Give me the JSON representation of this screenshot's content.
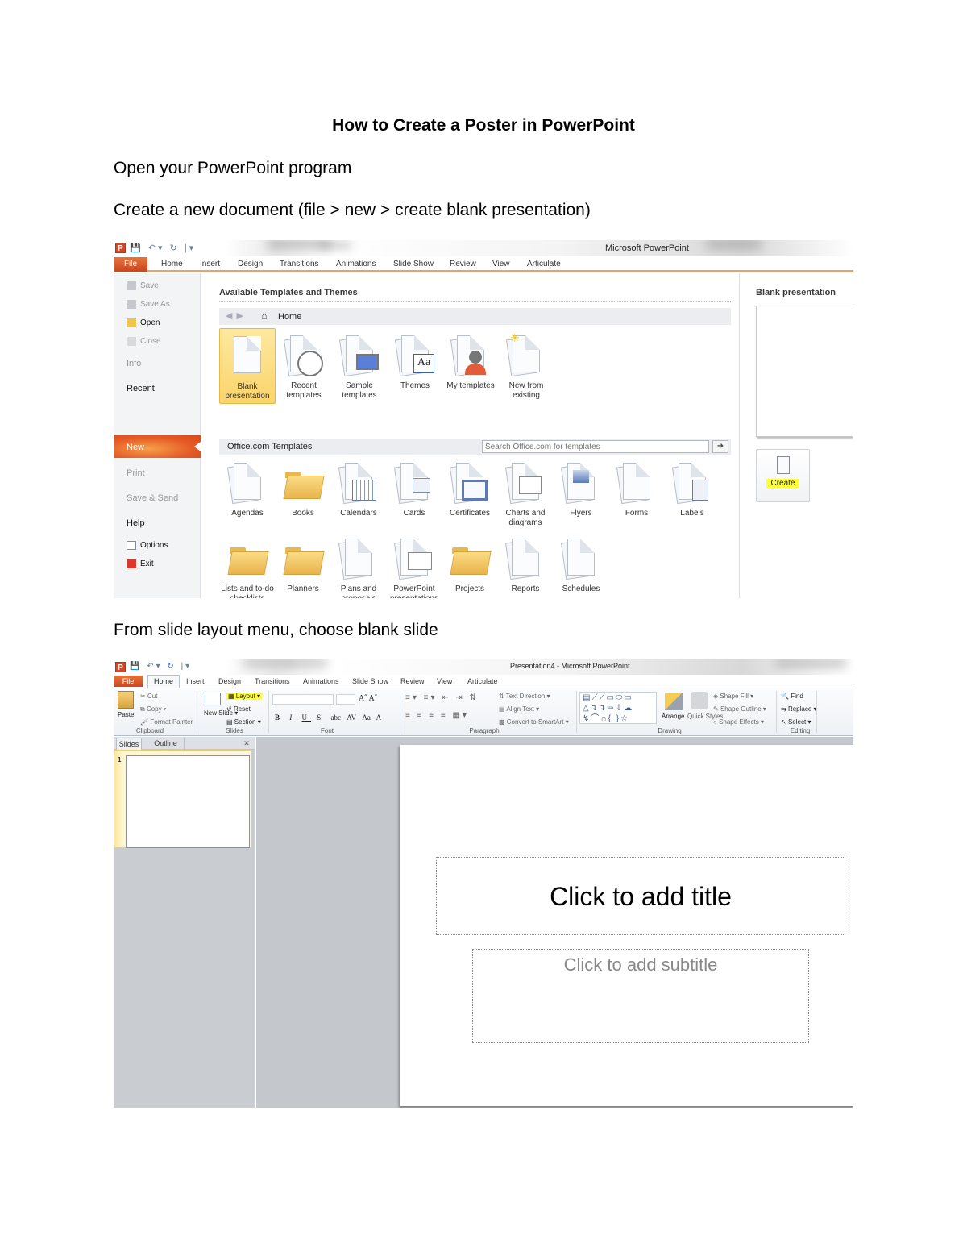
{
  "document": {
    "title": "How to Create a Poster in PowerPoint",
    "steps": [
      "Open your PowerPoint program",
      "Create a new document (file > new > create blank presentation)",
      "From slide layout menu, choose blank slide"
    ]
  },
  "screenshot1": {
    "window_title": "Microsoft PowerPoint",
    "tabs": [
      "File",
      "Home",
      "Insert",
      "Design",
      "Transitions",
      "Animations",
      "Slide Show",
      "Review",
      "View",
      "Articulate"
    ],
    "backstage_menu": [
      {
        "label": "Save",
        "state": "disabled"
      },
      {
        "label": "Save As",
        "state": "disabled"
      },
      {
        "label": "Open",
        "state": "enabled"
      },
      {
        "label": "Close",
        "state": "disabled"
      },
      {
        "label": "Info",
        "state": "disabled"
      },
      {
        "label": "Recent",
        "state": "enabled"
      },
      {
        "label": "New",
        "state": "selected"
      },
      {
        "label": "Print",
        "state": "disabled"
      },
      {
        "label": "Save & Send",
        "state": "disabled"
      },
      {
        "label": "Help",
        "state": "enabled"
      },
      {
        "label": "Options",
        "state": "enabled"
      },
      {
        "label": "Exit",
        "state": "enabled"
      }
    ],
    "section_title": "Available Templates and Themes",
    "nav_home": "Home",
    "top_templates": [
      "Blank presentation",
      "Recent templates",
      "Sample templates",
      "Themes",
      "My templates",
      "New from existing"
    ],
    "office_bar_label": "Office.com Templates",
    "search_placeholder": "Search Office.com for templates",
    "office_templates_row1": [
      "Agendas",
      "Books",
      "Calendars",
      "Cards",
      "Certificates",
      "Charts and diagrams",
      "Flyers",
      "Forms",
      "Labels"
    ],
    "office_templates_row2": [
      "Lists and to-do checklists",
      "Planners",
      "Plans and proposals",
      "PowerPoint presentations and slides",
      "Projects",
      "Reports",
      "Schedules"
    ],
    "preview_title": "Blank presentation",
    "create_label": "Create",
    "highlight_color": "#ffff3a",
    "accent_color": "#e55a25"
  },
  "screenshot2": {
    "window_title": "Presentation4 - Microsoft PowerPoint",
    "tabs": [
      "File",
      "Home",
      "Insert",
      "Design",
      "Transitions",
      "Animations",
      "Slide Show",
      "Review",
      "View",
      "Articulate"
    ],
    "ribbon": {
      "clipboard": {
        "paste": "Paste",
        "cut": "Cut",
        "copy": "Copy",
        "format_painter": "Format Painter",
        "label": "Clipboard"
      },
      "slides": {
        "new_slide": "New Slide",
        "layout": "Layout",
        "reset": "Reset",
        "section": "Section",
        "label": "Slides"
      },
      "font": {
        "label": "Font",
        "bold": "B",
        "italic": "I",
        "underline": "U",
        "shadow": "S",
        "strike": "abc",
        "spacing": "AV",
        "case": "Aa",
        "color": "A"
      },
      "paragraph": {
        "text_direction": "Text Direction",
        "align_text": "Align Text",
        "convert_smartart": "Convert to SmartArt",
        "label": "Paragraph"
      },
      "drawing": {
        "arrange": "Arrange",
        "quick_styles": "Quick Styles",
        "shape_fill": "Shape Fill",
        "shape_outline": "Shape Outline",
        "shape_effects": "Shape Effects",
        "label": "Drawing"
      },
      "editing": {
        "find": "Find",
        "replace": "Replace",
        "select": "Select",
        "label": "Editing"
      }
    },
    "pane_tabs": [
      "Slides",
      "Outline"
    ],
    "slide_number": "1",
    "title_placeholder": "Click to add title",
    "subtitle_placeholder": "Click to add subtitle"
  }
}
